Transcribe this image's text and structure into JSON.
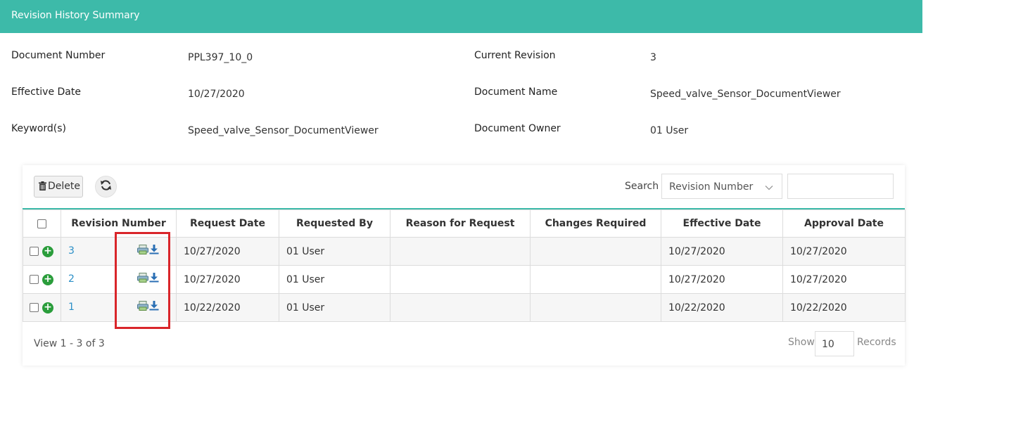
{
  "header": {
    "title": "Revision History Summary"
  },
  "info": {
    "document_number_label": "Document Number",
    "document_number_value": "PPL397_10_0",
    "current_revision_label": "Current Revision",
    "current_revision_value": "3",
    "effective_date_label": "Effective Date",
    "effective_date_value": "10/27/2020",
    "document_name_label": "Document Name",
    "document_name_value": "Speed_valve_Sensor_DocumentViewer",
    "keywords_label": "Keyword(s)",
    "keywords_value": "Speed_valve_Sensor_DocumentViewer",
    "document_owner_label": "Document Owner",
    "document_owner_value": "01 User"
  },
  "toolbar": {
    "delete_label": "Delete",
    "search_label": "Search",
    "search_field_selected": "Revision Number"
  },
  "table": {
    "columns": [
      "Revision Number",
      "Request Date",
      "Requested By",
      "Reason for Request",
      "Changes Required",
      "Effective Date",
      "Approval Date"
    ],
    "rows": [
      {
        "revision": "3",
        "request_date": "10/27/2020",
        "requested_by": "01 User",
        "reason": "",
        "changes": "",
        "effective_date": "10/27/2020",
        "approval_date": "10/27/2020"
      },
      {
        "revision": "2",
        "request_date": "10/27/2020",
        "requested_by": "01 User",
        "reason": "",
        "changes": "",
        "effective_date": "10/27/2020",
        "approval_date": "10/27/2020"
      },
      {
        "revision": "1",
        "request_date": "10/22/2020",
        "requested_by": "01 User",
        "reason": "",
        "changes": "",
        "effective_date": "10/22/2020",
        "approval_date": "10/22/2020"
      }
    ]
  },
  "footer": {
    "view_text": "View 1 - 3 of 3",
    "show_label": "Show",
    "page_size": "10",
    "records_label": "Records"
  },
  "icons": {
    "row_actions": [
      "document-viewer-icon",
      "download-icon"
    ],
    "add": "plus-circle-icon",
    "delete": "trash-icon",
    "refresh": "refresh-icon",
    "dropdown": "chevron-down-icon"
  },
  "colors": {
    "header_bg": "#3dbaa9",
    "link": "#2b8fc7",
    "add_icon": "#2a9d3b",
    "highlight": "#d9252a"
  }
}
